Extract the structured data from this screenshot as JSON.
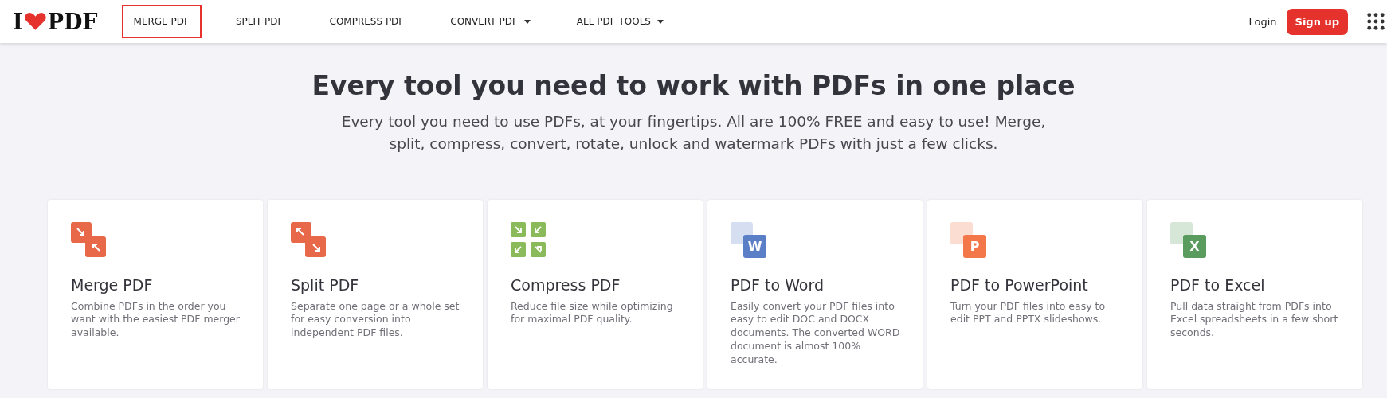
{
  "logo": {
    "left": "I",
    "right": "PDF"
  },
  "nav": [
    {
      "label": "MERGE PDF",
      "selected": true,
      "dropdown": false
    },
    {
      "label": "SPLIT PDF",
      "selected": false,
      "dropdown": false
    },
    {
      "label": "COMPRESS PDF",
      "selected": false,
      "dropdown": false
    },
    {
      "label": "CONVERT PDF",
      "selected": false,
      "dropdown": true
    },
    {
      "label": "ALL PDF TOOLS",
      "selected": false,
      "dropdown": true
    }
  ],
  "login": "Login",
  "signup": "Sign up",
  "hero": {
    "title": "Every tool you need to work with PDFs in one place",
    "subtitle": "Every tool you need to use PDFs, at your fingertips. All are 100% FREE and easy to use! Merge, split, compress, convert, rotate, unlock and watermark PDFs with just a few clicks."
  },
  "tools": [
    {
      "kind": "merge",
      "name": "Merge PDF",
      "description": "Combine PDFs in the order you want with the easiest PDF merger available.",
      "color": "#e8694a"
    },
    {
      "kind": "split",
      "name": "Split PDF",
      "description": "Separate one page or a whole set for easy conversion into independent PDF files.",
      "color": "#e8694a"
    },
    {
      "kind": "compress",
      "name": "Compress PDF",
      "description": "Reduce file size while optimizing for maximal PDF quality.",
      "color": "#8bba5a"
    },
    {
      "kind": "convert",
      "name": "PDF to Word",
      "description": "Easily convert your PDF files into easy to edit DOC and DOCX documents. The converted WORD document is almost 100% accurate.",
      "color": "#5b7fc7",
      "letter": "W"
    },
    {
      "kind": "convert",
      "name": "PDF to PowerPoint",
      "description": "Turn your PDF files into easy to edit PPT and PPTX slideshows.",
      "color": "#f4774a",
      "letter": "P"
    },
    {
      "kind": "convert",
      "name": "PDF to Excel",
      "description": "Pull data straight from PDFs into Excel spreadsheets in a few short seconds.",
      "color": "#5a9b5e",
      "letter": "X"
    }
  ]
}
